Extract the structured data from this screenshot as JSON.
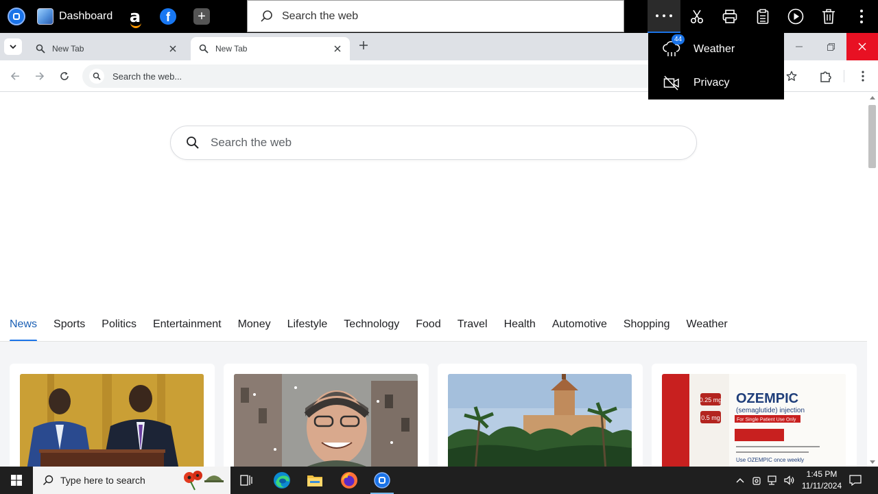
{
  "app_toolbar": {
    "dashboard_label": "Dashboard",
    "amazon_glyph": "a",
    "facebook_glyph": "f",
    "add_glyph": "+",
    "search_placeholder": "Search the web",
    "tools": [
      "more-icon",
      "scissors-icon",
      "print-icon",
      "clipboard-icon",
      "play-icon",
      "trash-icon",
      "kebab-icon"
    ]
  },
  "menu": {
    "items": [
      {
        "label": "Weather",
        "icon": "cloud-rain-icon",
        "badge": "44"
      },
      {
        "label": "Privacy",
        "icon": "camera-off-icon"
      }
    ]
  },
  "tabs": [
    {
      "title": "New Tab"
    },
    {
      "title": "New Tab",
      "active": true
    }
  ],
  "address_bar": {
    "placeholder": "Search the web..."
  },
  "page": {
    "search_placeholder": "Search the web",
    "categories": [
      "News",
      "Sports",
      "Politics",
      "Entertainment",
      "Money",
      "Lifestyle",
      "Technology",
      "Food",
      "Travel",
      "Health",
      "Automotive",
      "Shopping",
      "Weather"
    ],
    "active_category": "News",
    "cards": [
      {
        "image": "press-conference-photo"
      },
      {
        "image": "snowy-man-photo"
      },
      {
        "image": "palm-estate-photo"
      },
      {
        "image": "ozempic-box-photo",
        "caption_lines": [
          "0.25 mg",
          "0.5 mg",
          "OZEMPIC",
          "(semaglutide) injection",
          "For Single Patient Use Only",
          "Use OZEMPIC once weekly"
        ]
      }
    ]
  },
  "taskbar": {
    "search_placeholder": "Type here to search",
    "time": "1:45 PM",
    "date": "11/11/2024"
  },
  "colors": {
    "accent": "#1a73e8",
    "close_button": "#e81123",
    "toolbar_bg": "#000000"
  }
}
